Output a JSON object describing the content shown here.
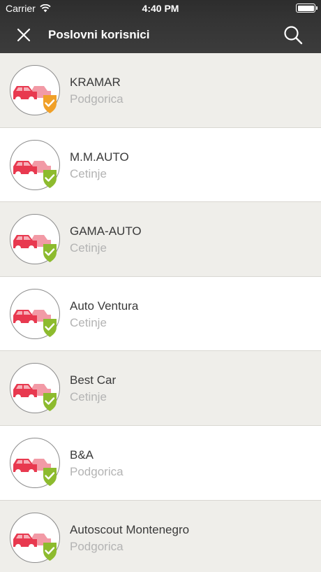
{
  "status_bar": {
    "carrier": "Carrier",
    "time": "4:40 PM"
  },
  "header": {
    "title": "Poslovni korisnici"
  },
  "colors": {
    "car_primary": "#e8394f",
    "car_secondary": "#f29aa6",
    "badge_green": "#8dbb2e",
    "badge_orange": "#f0a028"
  },
  "users": [
    {
      "name": "KRAMAR",
      "city": "Podgorica",
      "badge": "orange"
    },
    {
      "name": "M.M.AUTO",
      "city": "Cetinje",
      "badge": "green"
    },
    {
      "name": "GAMA-AUTO",
      "city": "Cetinje",
      "badge": "green"
    },
    {
      "name": "Auto Ventura",
      "city": "Cetinje",
      "badge": "green"
    },
    {
      "name": "Best Car",
      "city": "Cetinje",
      "badge": "green"
    },
    {
      "name": "B&A",
      "city": "Podgorica",
      "badge": "green"
    },
    {
      "name": "Autoscout Montenegro",
      "city": "Podgorica",
      "badge": "green"
    }
  ]
}
